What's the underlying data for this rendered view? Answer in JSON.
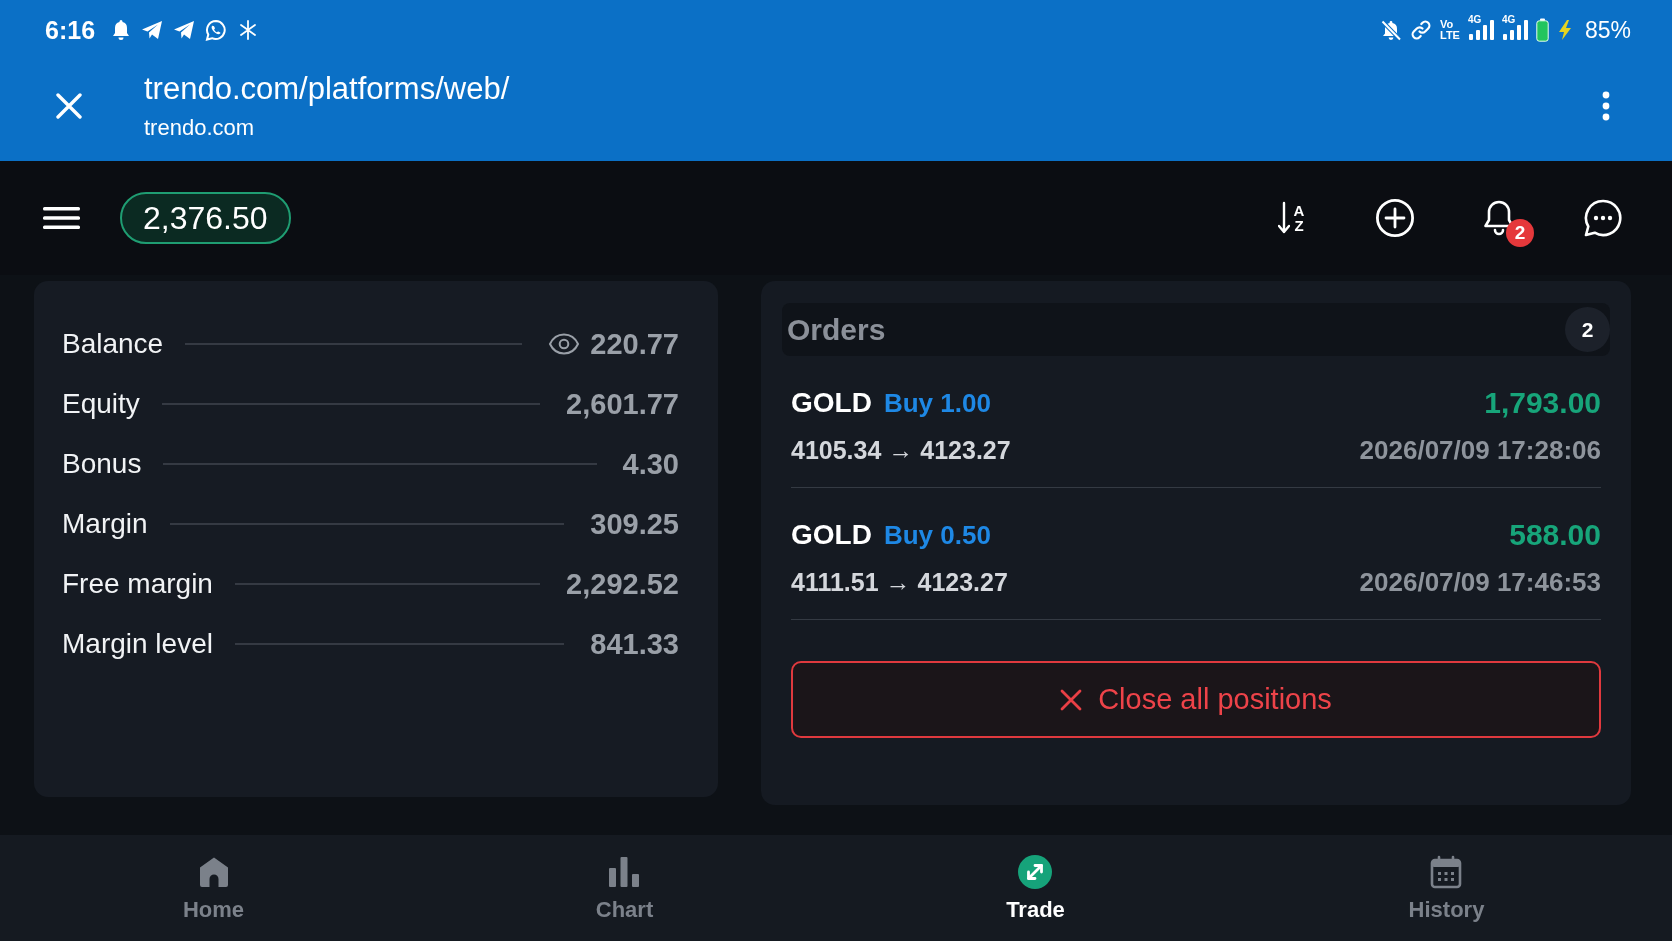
{
  "status_bar": {
    "time": "6:16",
    "volte": {
      "top": "Vo",
      "bottom": "LTE"
    },
    "networks": [
      {
        "type": "4G"
      },
      {
        "type": "4G"
      }
    ],
    "battery": "85%"
  },
  "browser_bar": {
    "url": "trendo.com/platforms/web/",
    "domain": "trendo.com"
  },
  "app_bar": {
    "balance": "2,376.50",
    "sort_letters": [
      "A",
      "Z"
    ],
    "notification_count": "2"
  },
  "account_summary": [
    {
      "label": "Balance",
      "value": "220.77",
      "kind": "hideable"
    },
    {
      "label": "Equity",
      "value": "2,601.77",
      "kind": "plain"
    },
    {
      "label": "Bonus",
      "value": "4.30",
      "kind": "plain"
    },
    {
      "label": "Margin",
      "value": "309.25",
      "kind": "plain"
    },
    {
      "label": "Free margin",
      "value": "2,292.52",
      "kind": "plain"
    },
    {
      "label": "Margin level",
      "value": "841.33",
      "kind": "plain"
    }
  ],
  "orders": {
    "title": "Orders",
    "count": "2",
    "items": [
      {
        "symbol": "GOLD",
        "side": "Buy 1.00",
        "profit": "1,793.00",
        "prices": "4105.34 → 4123.27",
        "time": "2026/07/09 17:28:06"
      },
      {
        "symbol": "GOLD",
        "side": "Buy 0.50",
        "profit": "588.00",
        "prices": "4111.51 → 4123.27",
        "time": "2026/07/09 17:46:53"
      }
    ],
    "close_all_label": "Close all positions"
  },
  "bottom_nav": [
    {
      "label": "Home",
      "selected": false
    },
    {
      "label": "Chart",
      "selected": false
    },
    {
      "label": "Trade",
      "selected": true
    },
    {
      "label": "History",
      "selected": false
    }
  ]
}
